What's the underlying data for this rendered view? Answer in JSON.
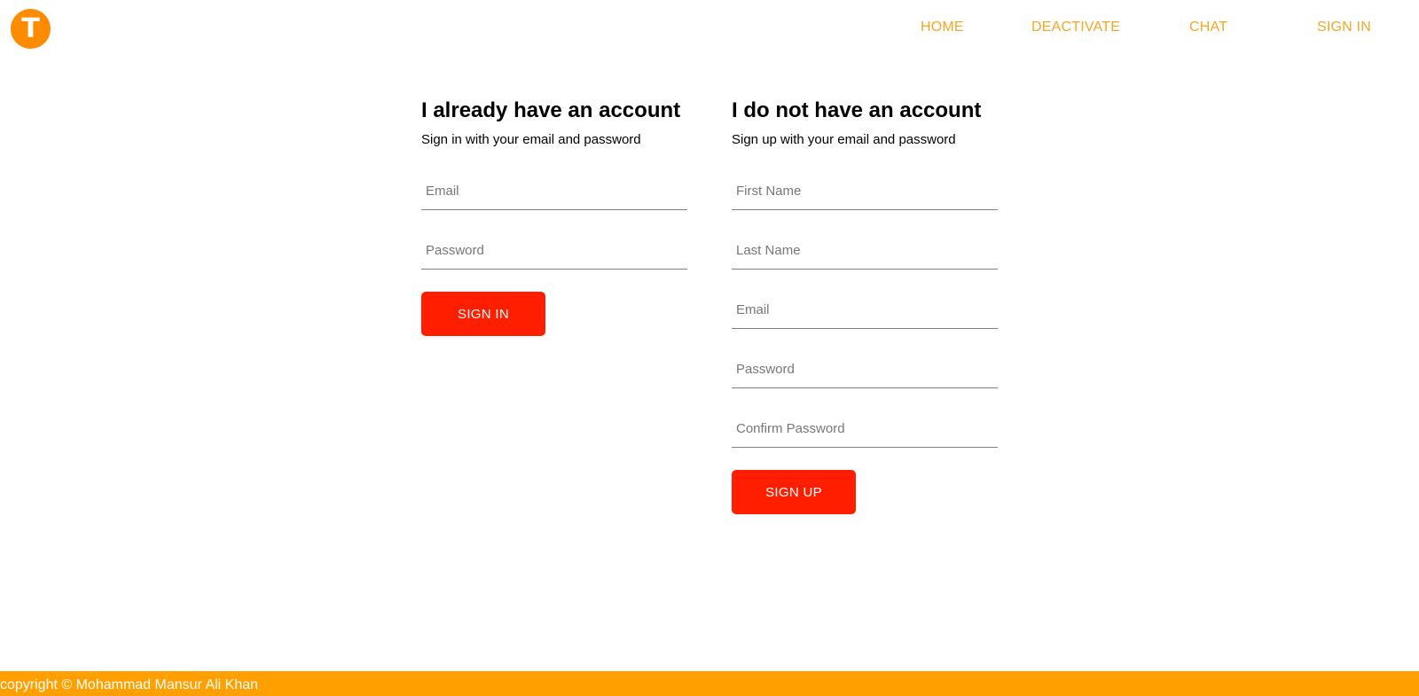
{
  "header": {
    "logo_letter": "T",
    "nav": {
      "home": "HOME",
      "deactivate": "DEACTIVATE",
      "chat": "CHAT",
      "sign_in": "SIGN IN"
    }
  },
  "signin": {
    "title": "I already have an account",
    "subtitle": "Sign in with your email and password",
    "email_placeholder": "Email",
    "password_placeholder": "Password",
    "button": "SIGN IN"
  },
  "signup": {
    "title": "I do not have an account",
    "subtitle": "Sign up with your email and password",
    "first_name_placeholder": "First Name",
    "last_name_placeholder": "Last Name",
    "email_placeholder": "Email",
    "password_placeholder": "Password",
    "confirm_password_placeholder": "Confirm Password",
    "button": "SIGN UP"
  },
  "footer": {
    "text": "copyright © Mohammad Mansur Ali Khan"
  },
  "colors": {
    "logo": "#ff8c00",
    "nav_link": "#f5a623",
    "button": "#ff1e00",
    "footer": "#ffa000"
  }
}
